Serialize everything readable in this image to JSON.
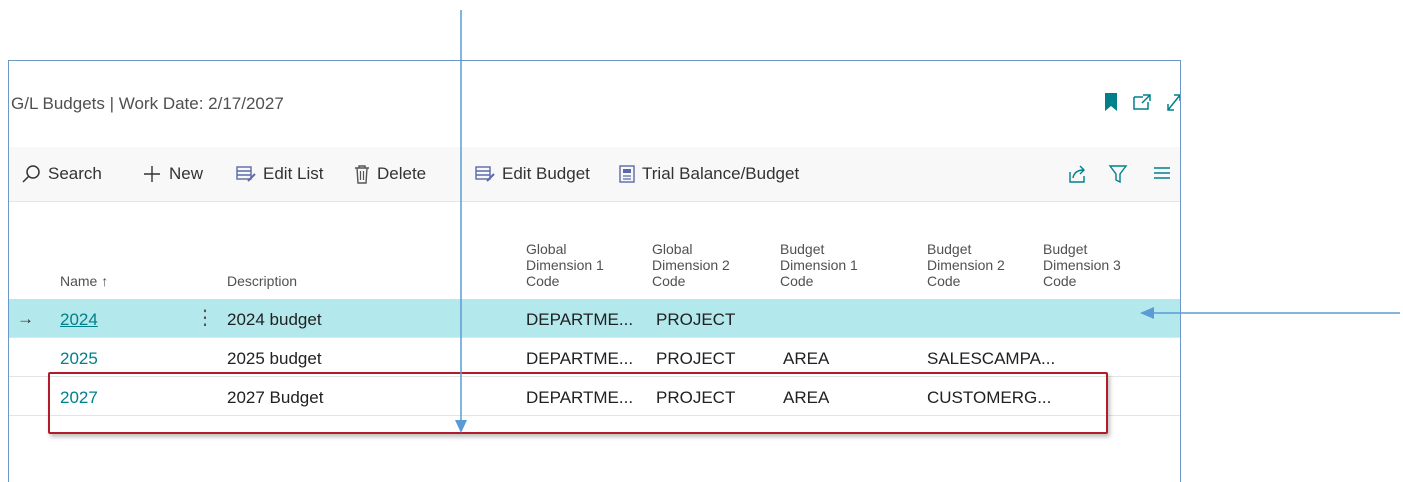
{
  "window": {
    "title": "G/L Budgets | Work Date: 2/17/2027",
    "icons": [
      "bookmark-icon",
      "open-new-window-icon",
      "expand-icon"
    ]
  },
  "toolbar": {
    "search_label": "Search",
    "new_label": "New",
    "edit_list_label": "Edit List",
    "delete_label": "Delete",
    "edit_budget_label": "Edit Budget",
    "trial_balance_label": "Trial Balance/Budget",
    "right_icons": [
      "share-icon",
      "filter-icon",
      "list-view-icon"
    ]
  },
  "table": {
    "headers": {
      "name": "Name ↑",
      "description": "Description",
      "global_dim1": "Global\nDimension 1\nCode",
      "global_dim2": "Global\nDimension 2\nCode",
      "budget_dim1": "Budget\nDimension 1\nCode",
      "budget_dim2": "Budget\nDimension 2\nCode",
      "budget_dim3": "Budget\nDimension 3\nCode"
    },
    "rows": [
      {
        "name": "2024",
        "description": "2024 budget",
        "global_dim1": "DEPARTME...",
        "global_dim2": "PROJECT",
        "budget_dim1": "",
        "budget_dim2": "",
        "budget_dim3": ""
      },
      {
        "name": "2025",
        "description": "2025 budget",
        "global_dim1": "DEPARTME...",
        "global_dim2": "PROJECT",
        "budget_dim1": "AREA",
        "budget_dim2": "SALESCAMPA...",
        "budget_dim3": ""
      },
      {
        "name": "2027",
        "description": "2027 Budget",
        "global_dim1": "DEPARTME...",
        "global_dim2": "PROJECT",
        "budget_dim1": "AREA",
        "budget_dim2": "CUSTOMERG...",
        "budget_dim3": ""
      }
    ],
    "selected_row": "2024"
  },
  "colors": {
    "accent": "#00808a",
    "selected_row": "#b3e8ec",
    "annotation_arrow": "#5b9bd5",
    "highlight_box": "#b01c2a"
  }
}
